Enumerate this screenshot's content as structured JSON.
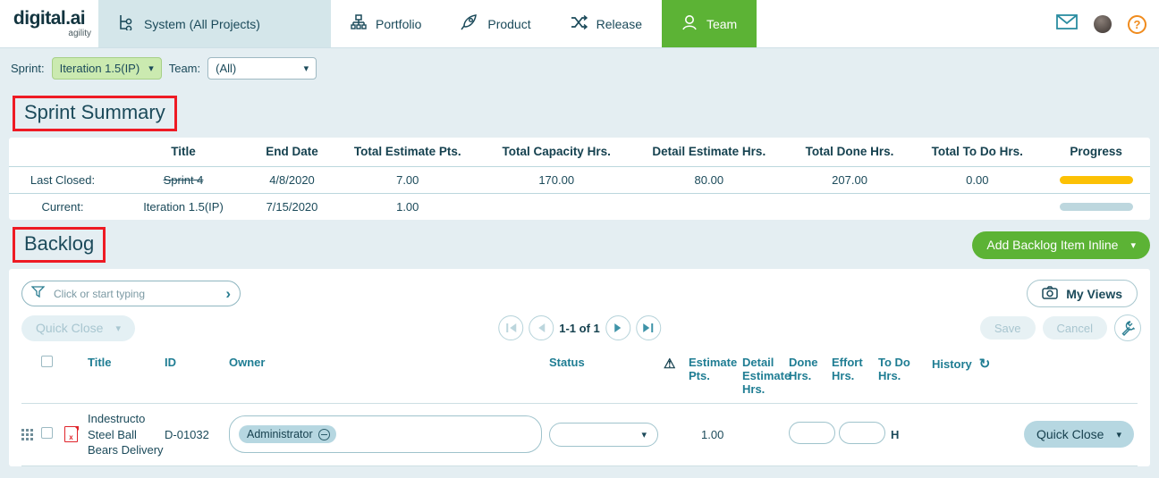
{
  "brand": {
    "name": "digital.ai",
    "sub": "agility"
  },
  "topnav": {
    "context_tab": {
      "label": "System (All Projects)",
      "icon": "hierarchy-icon"
    },
    "items": [
      {
        "label": "Portfolio",
        "icon": "org-chart-icon",
        "active": false
      },
      {
        "label": "Product",
        "icon": "rocket-icon",
        "active": false
      },
      {
        "label": "Release",
        "icon": "shuffle-icon",
        "active": false
      },
      {
        "label": "Team",
        "icon": "person-icon",
        "active": true
      }
    ],
    "right_icons": [
      {
        "name": "mail-icon"
      },
      {
        "name": "avatar"
      },
      {
        "name": "help-icon",
        "glyph": "?"
      }
    ],
    "active_color": "#5cb335"
  },
  "filterbar": {
    "sprint_label": "Sprint:",
    "sprint_value": "Iteration 1.5(IP)",
    "team_label": "Team:",
    "team_value": "(All)"
  },
  "sprint_summary": {
    "heading": "Sprint Summary",
    "heading_annotation_color": "#ee1b24",
    "columns": [
      "",
      "Title",
      "End Date",
      "Total Estimate Pts.",
      "Total Capacity Hrs.",
      "Detail Estimate Hrs.",
      "Total Done Hrs.",
      "Total To Do Hrs.",
      "Progress"
    ],
    "rows": [
      {
        "label": "Last Closed:",
        "title": "Sprint 4",
        "title_struck": true,
        "end_date": "4/8/2020",
        "total_estimate_pts": "7.00",
        "total_capacity_hrs": "170.00",
        "detail_estimate_hrs": "80.00",
        "total_done_hrs": "207.00",
        "total_todo_hrs": "0.00",
        "progress_color": "#fcc105",
        "progress_pct": 100
      },
      {
        "label": "Current:",
        "title": "Iteration 1.5(IP)",
        "title_struck": false,
        "end_date": "7/15/2020",
        "total_estimate_pts": "1.00",
        "total_capacity_hrs": "",
        "detail_estimate_hrs": "",
        "total_done_hrs": "",
        "total_todo_hrs": "",
        "progress_color": "#bdd7de",
        "progress_pct": 100
      }
    ]
  },
  "backlog": {
    "heading": "Backlog",
    "heading_annotation_color": "#ee1b24",
    "add_button": "Add Backlog Item Inline",
    "filter_placeholder": "Click or start typing",
    "filter_icon": "funnel-icon",
    "filter_chevron": "›",
    "my_views": "My Views",
    "my_views_icon": "camera-icon",
    "quick_close_toolbar": "Quick Close",
    "pager_text": "1-1 of 1",
    "save_label": "Save",
    "cancel_label": "Cancel",
    "wrench_icon": "wrench-icon",
    "columns": {
      "title": "Title",
      "id": "ID",
      "owner": "Owner",
      "status": "Status",
      "warn_icon": "warning-triangle-icon",
      "estimate_pts": "Estimate Pts.",
      "detail_estimate_hrs": "Detail Estimate Hrs.",
      "done_hrs": "Done Hrs.",
      "effort_hrs": "Effort Hrs.",
      "todo_hrs": "To Do Hrs.",
      "history": "History",
      "history_icon": "refresh-icon"
    },
    "rows": [
      {
        "drag_handle": "drag-handle-icon",
        "type_icon": "defect-icon",
        "title": "Indestructo Steel Ball Bears Delivery",
        "id": "D-01032",
        "owner_chip": "Administrator",
        "status_value": "",
        "estimate_pts": "1.00",
        "done_hrs": "",
        "effort_hrs": "",
        "todo_unit": "H",
        "quick_close": "Quick Close"
      }
    ]
  }
}
